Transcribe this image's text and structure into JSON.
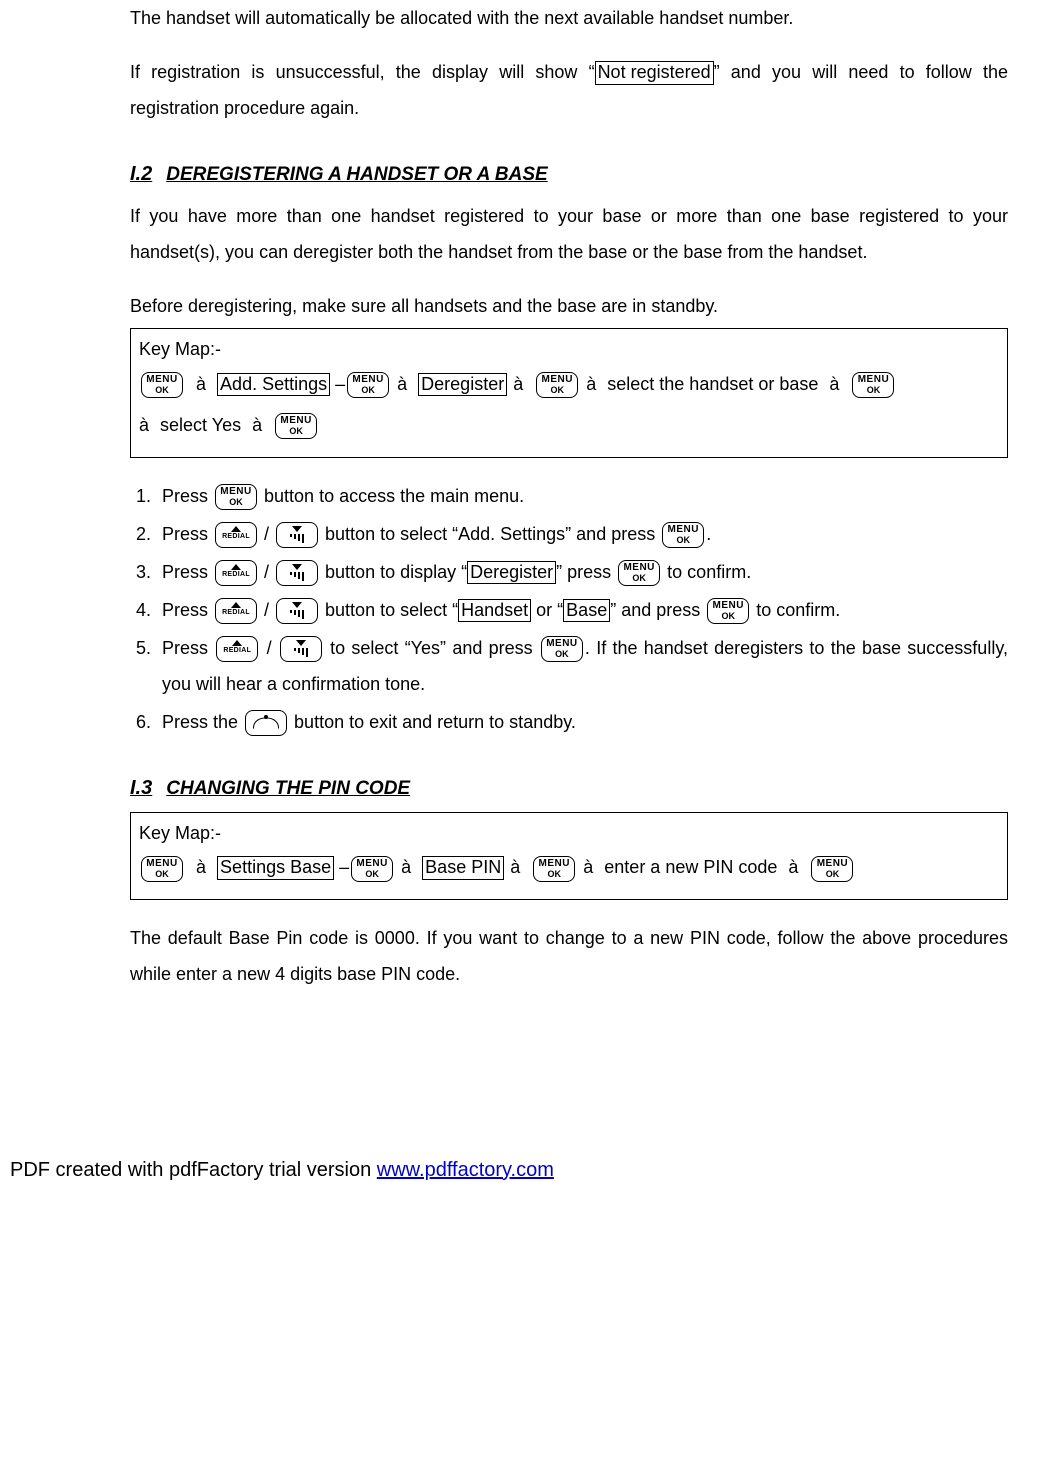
{
  "intro": {
    "p1": "The handset will automatically be allocated with the next available handset number.",
    "p2a": "If registration is unsuccessful, the display will show “",
    "p2_boxed": "Not registered",
    "p2b": "” and you will need to follow the registration procedure again."
  },
  "sec_i2": {
    "num": "I.2",
    "title": "DEREGISTERING A HANDSET OR A BASE",
    "p1": "If you have more than one handset registered to your base or more than one base registered to your handset(s), you can deregister both the handset from the base or the base from the handset.",
    "p2": "Before deregistering, make sure all handsets and the base are in standby."
  },
  "keymap1": {
    "title": "Key Map:-",
    "arrow": "à",
    "box1": "Add. Settings",
    "box2": "Deregister",
    "txt1": "select the handset or base",
    "txt2": "select Yes"
  },
  "btn_labels": {
    "menu1": "MENU",
    "menu2": "OK",
    "redial": "REDIAL"
  },
  "steps_i2": {
    "s1a": "Press ",
    "s1b": " button to access the main menu.",
    "s2a": "Press ",
    "s2b": " / ",
    "s2c": " button to select “Add. Settings” and press ",
    "s2d": ".",
    "s3a": "Press ",
    "s3b": " / ",
    "s3c": " button to display “",
    "s3_box": "Deregister",
    "s3d": "” press ",
    "s3e": " to confirm.",
    "s4a": "Press ",
    "s4b": " / ",
    "s4c": " button to select “",
    "s4_box1": "Handset",
    "s4d": " or “",
    "s4_box2": "Base",
    "s4e": "” and press ",
    "s4f": " to confirm.",
    "s5a": "Press ",
    "s5b": " / ",
    "s5c": " to select “Yes” and press ",
    "s5d": ". If the handset deregisters to the base successfully, you will hear a confirmation tone.",
    "s6a": "Press the ",
    "s6b": " button to exit and return to standby."
  },
  "sec_i3": {
    "num": "I.3",
    "title": "CHANGING THE PIN CODE"
  },
  "keymap2": {
    "title": "Key Map:-",
    "arrow": "à",
    "box1": "Settings Base",
    "box2": "Base PIN",
    "txt1": "enter a new PIN code"
  },
  "p_after_km2": "The default Base Pin code is 0000. If you want to change to a new PIN code, follow the above procedures while enter a new 4 digits base PIN code.",
  "footer": {
    "pre": "PDF created with pdfFactory trial version ",
    "link_text": "www.pdffactory.com"
  }
}
